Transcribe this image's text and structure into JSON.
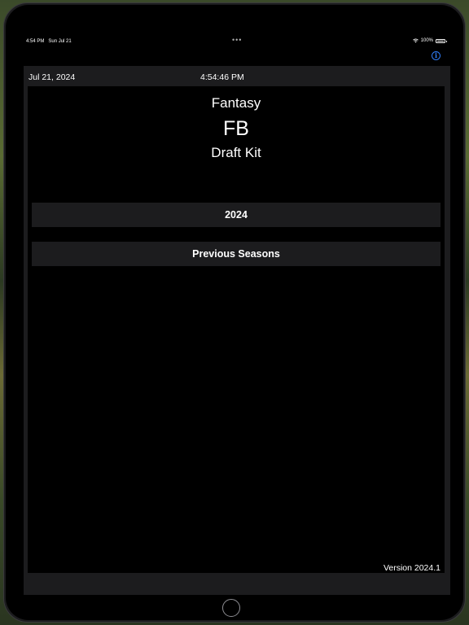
{
  "status_bar": {
    "time": "4:54 PM",
    "date": "Sun Jul 21",
    "multitask_dots": "•••",
    "battery": "100%"
  },
  "header": {
    "date": "Jul 21, 2024",
    "time": "4:54:46 PM"
  },
  "title": {
    "line1": "Fantasy",
    "line2": "FB",
    "line3": "Draft Kit"
  },
  "buttons": {
    "current_season": "2024",
    "previous_seasons": "Previous Seasons"
  },
  "footer": {
    "version": "Version 2024.1"
  },
  "info": {
    "glyph": "i"
  },
  "colors": {
    "accent": "#2f7cf6",
    "background": "#000000",
    "panel": "#1c1c1e",
    "text": "#ffffff"
  },
  "icons": [
    "wifi-icon",
    "battery-icon",
    "info-icon",
    "home-button-icon"
  ]
}
